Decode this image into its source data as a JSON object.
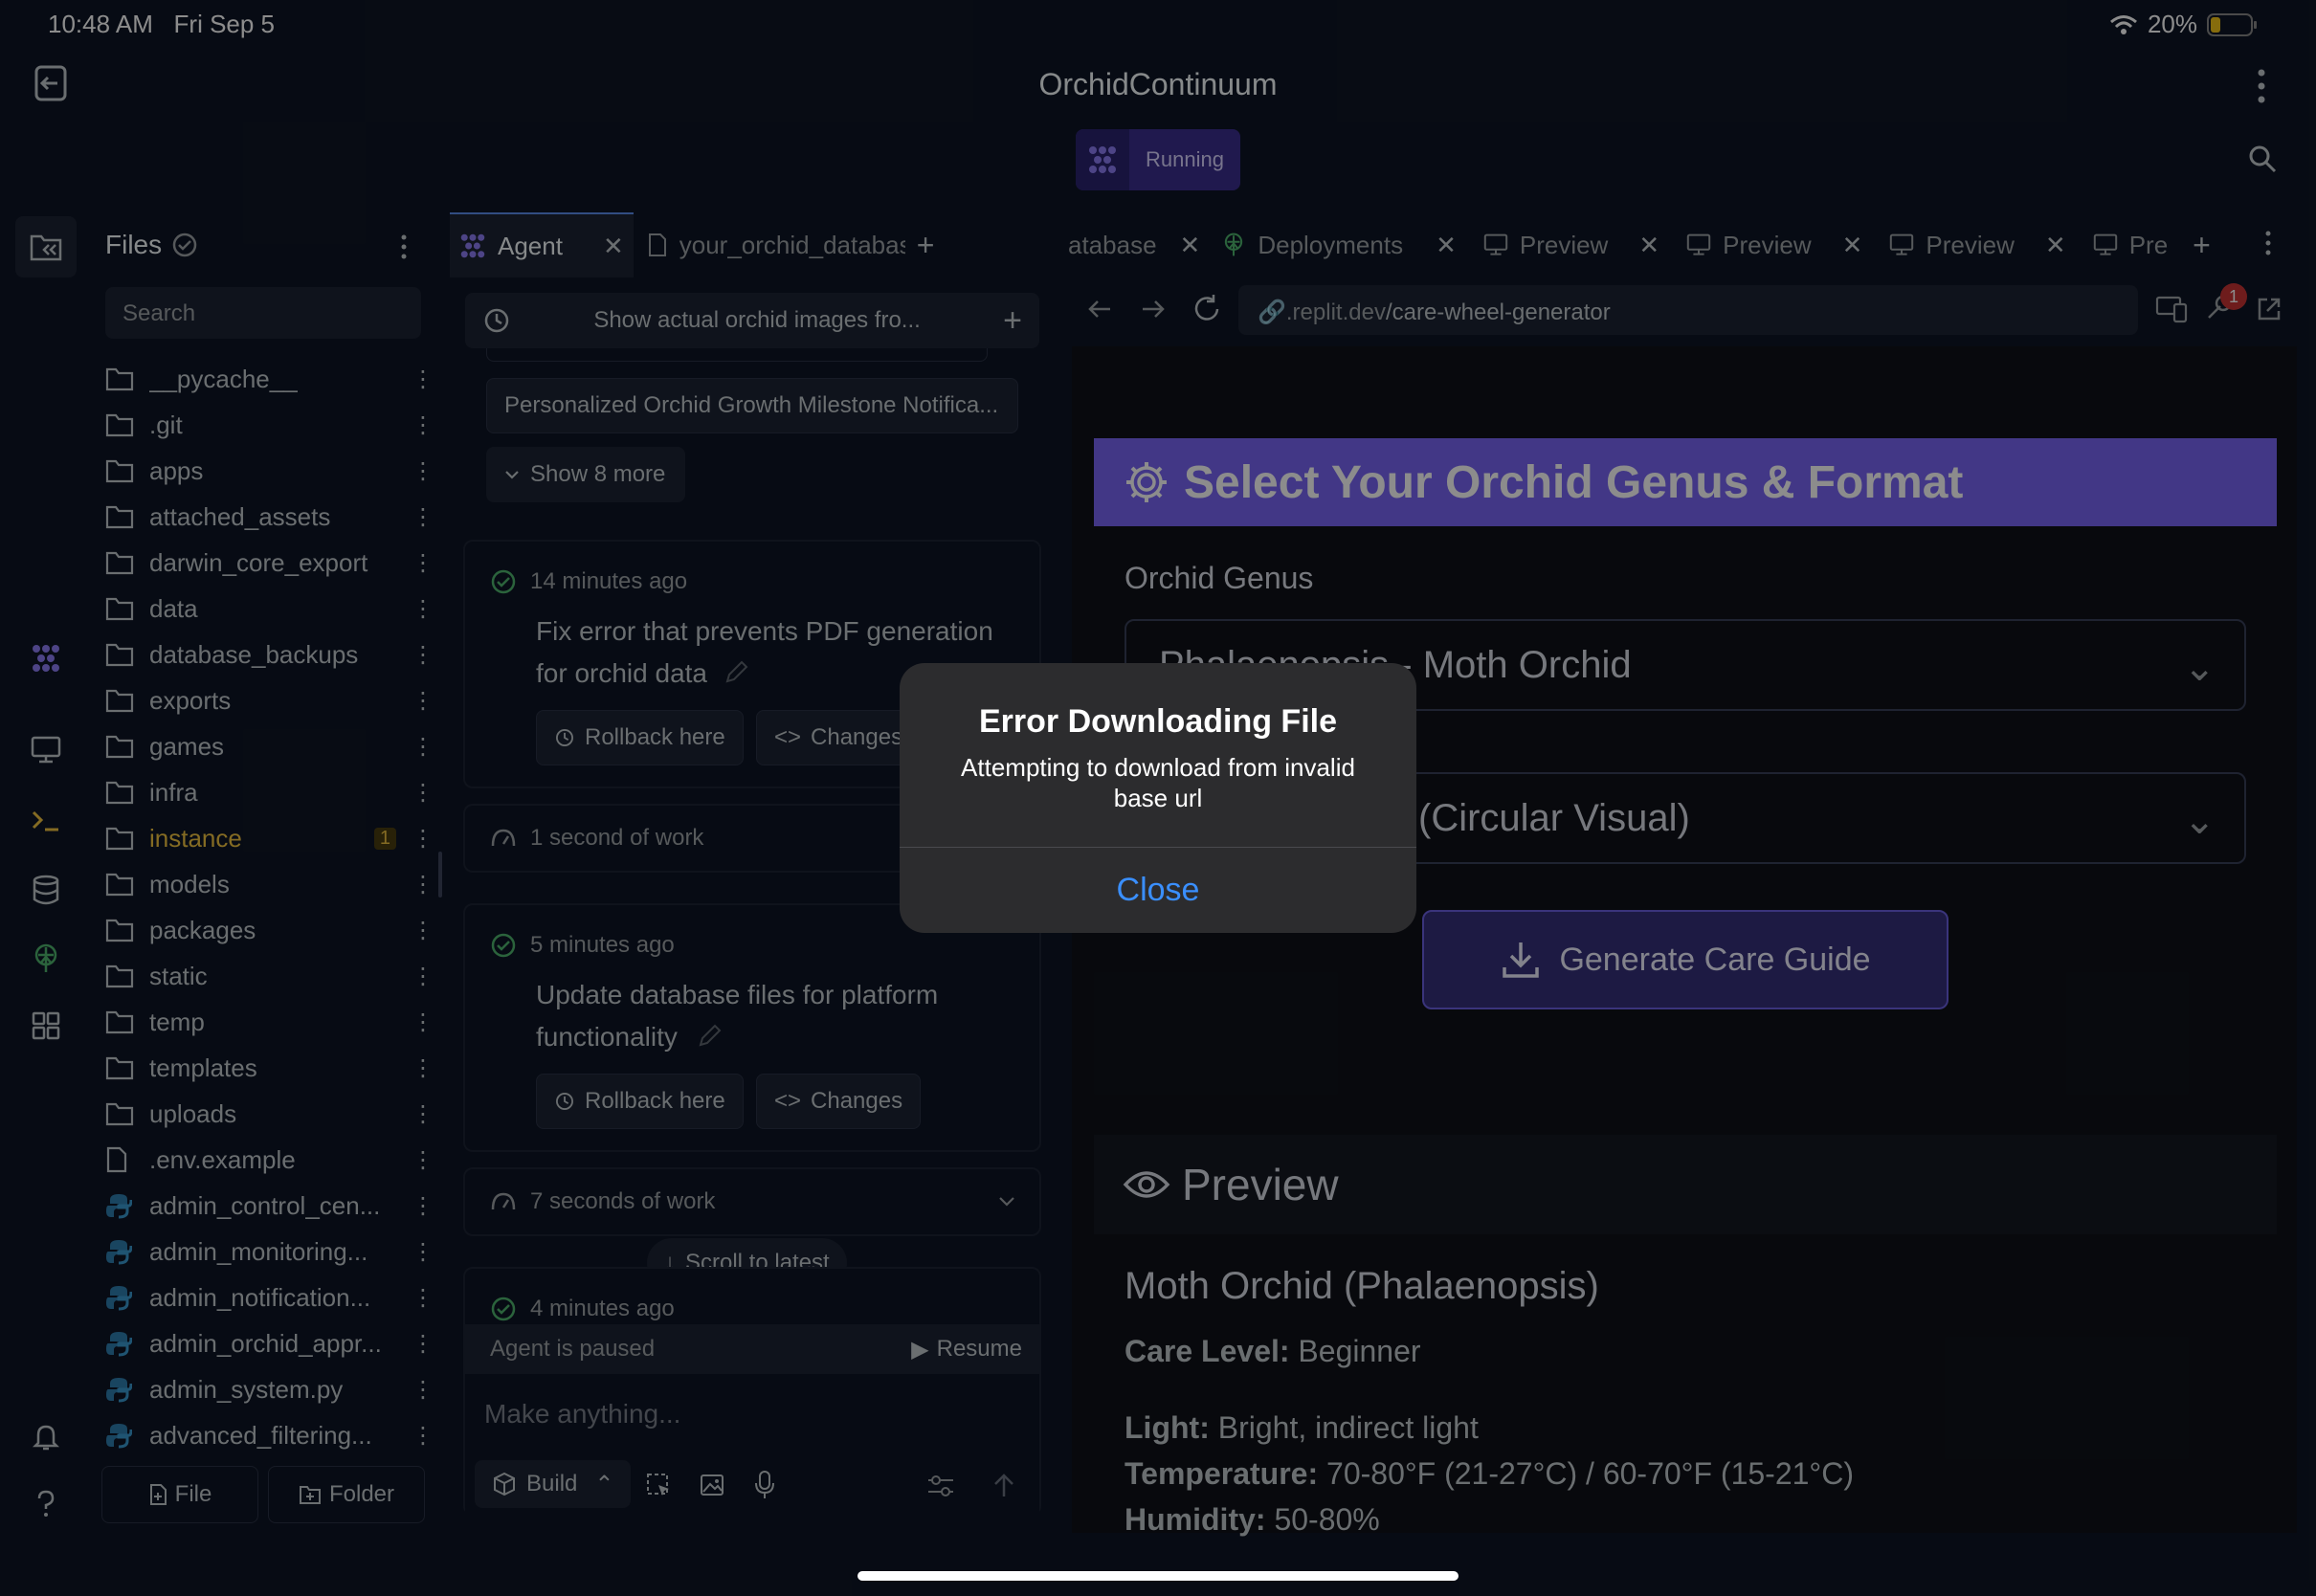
{
  "status_bar": {
    "time": "10:48 AM",
    "date": "Fri Sep 5",
    "battery": "20%"
  },
  "header": {
    "title": "OrchidContinuum",
    "running_label": "Running"
  },
  "files": {
    "title": "Files",
    "search_placeholder": "Search",
    "items": [
      {
        "name": "__pycache__",
        "type": "folder"
      },
      {
        "name": ".git",
        "type": "folder"
      },
      {
        "name": "apps",
        "type": "folder"
      },
      {
        "name": "attached_assets",
        "type": "folder"
      },
      {
        "name": "darwin_core_export",
        "type": "folder"
      },
      {
        "name": "data",
        "type": "folder"
      },
      {
        "name": "database_backups",
        "type": "folder"
      },
      {
        "name": "exports",
        "type": "folder"
      },
      {
        "name": "games",
        "type": "folder"
      },
      {
        "name": "infra",
        "type": "folder"
      },
      {
        "name": "instance",
        "type": "folder",
        "badge": "1"
      },
      {
        "name": "models",
        "type": "folder"
      },
      {
        "name": "packages",
        "type": "folder"
      },
      {
        "name": "static",
        "type": "folder"
      },
      {
        "name": "temp",
        "type": "folder"
      },
      {
        "name": "templates",
        "type": "folder"
      },
      {
        "name": "uploads",
        "type": "folder"
      },
      {
        "name": ".env.example",
        "type": "file"
      },
      {
        "name": "admin_control_cen...",
        "type": "python"
      },
      {
        "name": "admin_monitoring...",
        "type": "python"
      },
      {
        "name": "admin_notification...",
        "type": "python"
      },
      {
        "name": "admin_orchid_appr...",
        "type": "python"
      },
      {
        "name": "admin_system.py",
        "type": "python"
      },
      {
        "name": "advanced_filtering...",
        "type": "python"
      }
    ],
    "file_button": "File",
    "folder_button": "Folder"
  },
  "agent": {
    "tab_agent": "Agent",
    "tab_file": "your_orchid_databas",
    "history_title": "Show actual orchid images fro...",
    "milestone_item": "Personalized Orchid Growth Milestone Notifica...",
    "show_more": "Show 8 more",
    "checkpoints": [
      {
        "time": "14 minutes ago",
        "title": "Fix error that prevents PDF generation for orchid data",
        "rollback": "Rollback here",
        "changes": "Changes"
      },
      {
        "time": "5 minutes ago",
        "title": "Update database files for platform functionality",
        "rollback": "Rollback here",
        "changes": "Changes"
      }
    ],
    "work1": "1 second of work",
    "work2": "7 seconds of work",
    "scroll_latest": "Scroll to latest",
    "last_time": "4 minutes ago",
    "paused": "Agent is paused",
    "resume": "Resume",
    "input_placeholder": "Make anything...",
    "build": "Build"
  },
  "preview": {
    "tabs": [
      "atabase",
      "Deployments",
      "Preview",
      "Preview",
      "Preview",
      "Pre"
    ],
    "url_host": ".replit.dev",
    "url_path": "/care-wheel-generator",
    "notification_count": "1",
    "banner_title": "Select Your Orchid Genus & Format",
    "genus_label": "Orchid Genus",
    "genus_value": "Phalaenopsis - Moth Orchid",
    "format_value": "(Circular Visual)",
    "generate_button": "Generate Care Guide",
    "preview_title": "Preview",
    "orchid_name": "Moth Orchid (Phalaenopsis)",
    "care": [
      {
        "label": "Care Level:",
        "value": "Beginner"
      },
      {
        "label": "Light:",
        "value": "Bright, indirect light"
      },
      {
        "label": "Temperature:",
        "value": "70-80°F (21-27°C) / 60-70°F (15-21°C)"
      },
      {
        "label": "Humidity:",
        "value": "50-80%"
      }
    ]
  },
  "dialog": {
    "title": "Error Downloading File",
    "message": "Attempting to download from invalid base url",
    "close": "Close"
  },
  "colors": {
    "accent": "#7864f5",
    "link": "#3a8fff",
    "bg": "#0e1525"
  }
}
